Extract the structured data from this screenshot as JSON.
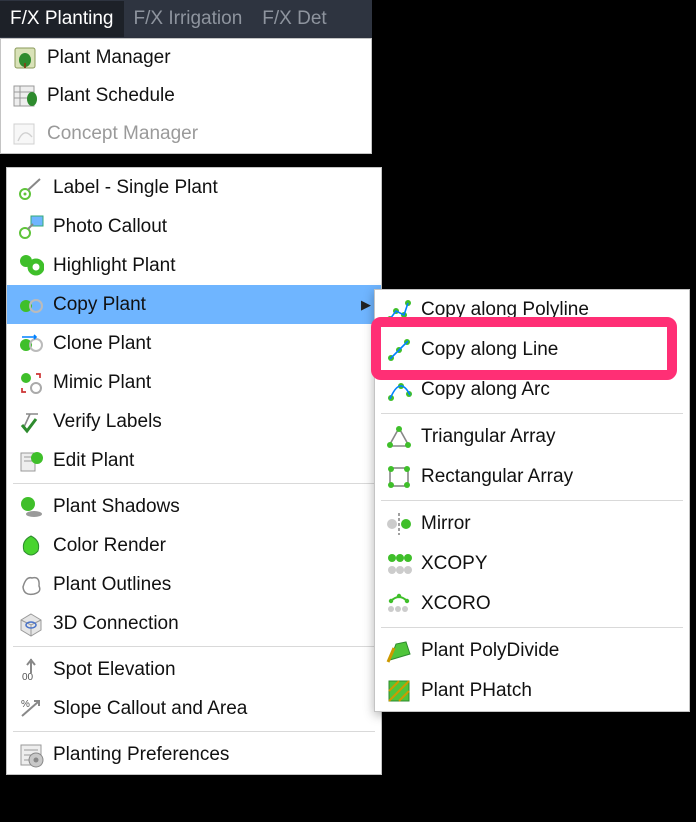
{
  "menubar": {
    "items": [
      {
        "label": "F/X Planting",
        "active": true
      },
      {
        "label": "F/X Irrigation",
        "active": false
      },
      {
        "label": "F/X Det",
        "active": false
      }
    ]
  },
  "upper_menu": {
    "items": [
      {
        "label": "Plant Manager",
        "icon": "plant-manager-icon"
      },
      {
        "label": "Plant Schedule",
        "icon": "plant-schedule-icon"
      },
      {
        "label": "Concept Manager",
        "icon": "concept-manager-icon"
      }
    ]
  },
  "main_menu": {
    "items": [
      {
        "label": "Label - Single Plant",
        "icon": "label-single-icon"
      },
      {
        "label": "Photo Callout",
        "icon": "photo-callout-icon"
      },
      {
        "label": "Highlight Plant",
        "icon": "highlight-plant-icon"
      },
      {
        "label": "Copy Plant",
        "icon": "copy-plant-icon",
        "highlight": true,
        "submenu": true
      },
      {
        "label": "Clone Plant",
        "icon": "clone-plant-icon"
      },
      {
        "label": "Mimic Plant",
        "icon": "mimic-plant-icon"
      },
      {
        "label": "Verify Labels",
        "icon": "verify-labels-icon"
      },
      {
        "label": "Edit Plant",
        "icon": "edit-plant-icon"
      },
      {
        "sep": true
      },
      {
        "label": "Plant Shadows",
        "icon": "plant-shadows-icon"
      },
      {
        "label": "Color Render",
        "icon": "color-render-icon"
      },
      {
        "label": "Plant Outlines",
        "icon": "plant-outlines-icon"
      },
      {
        "label": "3D Connection",
        "icon": "connection-3d-icon"
      },
      {
        "sep": true
      },
      {
        "label": "Spot Elevation",
        "icon": "spot-elevation-icon"
      },
      {
        "label": "Slope Callout and Area",
        "icon": "slope-callout-icon"
      },
      {
        "sep": true
      },
      {
        "label": "Planting Preferences",
        "icon": "planting-prefs-icon"
      }
    ]
  },
  "submenu": {
    "items": [
      {
        "label": "Copy along Polyline",
        "icon": "copy-polyline-icon"
      },
      {
        "label": "Copy along Line",
        "icon": "copy-line-icon"
      },
      {
        "label": "Copy along Arc",
        "icon": "copy-arc-icon"
      },
      {
        "sep": true
      },
      {
        "label": "Triangular Array",
        "icon": "tri-array-icon"
      },
      {
        "label": "Rectangular Array",
        "icon": "rect-array-icon"
      },
      {
        "sep": true
      },
      {
        "label": "Mirror",
        "icon": "mirror-icon"
      },
      {
        "label": "XCOPY",
        "icon": "xcopy-icon"
      },
      {
        "label": "XCORO",
        "icon": "xcoro-icon"
      },
      {
        "sep": true
      },
      {
        "label": "Plant PolyDivide",
        "icon": "polydivide-icon"
      },
      {
        "label": "Plant PHatch",
        "icon": "phatch-icon"
      }
    ]
  },
  "colors": {
    "accent_highlight_bg": "#6fb5ff",
    "callout_border": "#ff2f75",
    "menubar_bg": "#2e3440",
    "icon_green": "#3fbf2a"
  }
}
